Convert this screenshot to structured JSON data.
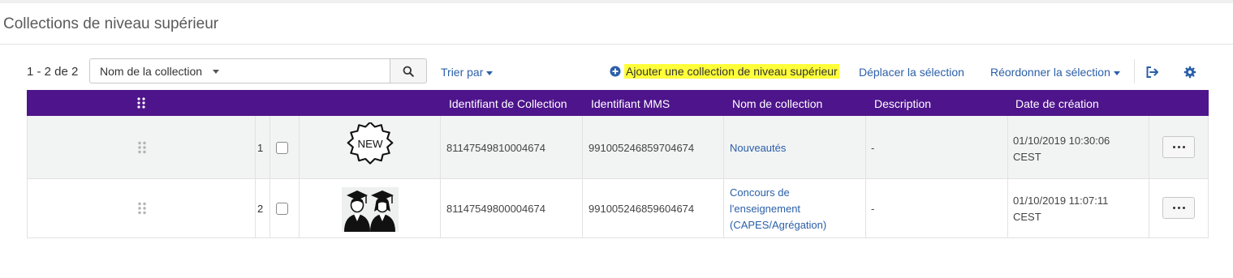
{
  "page": {
    "title": "Collections de niveau supérieur"
  },
  "toolbar": {
    "count": "1 - 2 de 2",
    "search_field": "Nom de la collection",
    "search_value": "",
    "sort_label": "Trier par",
    "add_label": "Ajouter une collection de niveau supérieur",
    "move_label": "Déplacer la sélection",
    "reorder_label": "Réordonner la sélection"
  },
  "table": {
    "columns": [
      "Identifiant de Collection",
      "Identifiant MMS",
      "Nom de collection",
      "Description",
      "Date de création"
    ],
    "rows": [
      {
        "order": "1",
        "collection_id": "81147549810004674",
        "mms_id": "991005246859704674",
        "name": "Nouveautés",
        "description": "-",
        "date": "01/10/2019 10:30:06",
        "tz": "CEST",
        "thumb_text": "NEW"
      },
      {
        "order": "2",
        "collection_id": "81147549800004674",
        "mms_id": "991005246859604674",
        "name": "Concours de l'enseignement (CAPES/Agrégation)",
        "name_lines": [
          "Concours de",
          "l'enseignement",
          "(CAPES/Agrégation)"
        ],
        "description": "-",
        "date": "01/10/2019 11:07:11",
        "tz": "CEST"
      }
    ]
  },
  "colors": {
    "header_bg": "#4e148c",
    "link": "#2b5fa8",
    "highlight": "#ffff3a"
  },
  "icons": [
    "search-icon",
    "plus-circle-icon",
    "export-icon",
    "gear-icon",
    "drag-handle-icon",
    "new-badge-icon",
    "graduates-icon",
    "more-icon"
  ]
}
